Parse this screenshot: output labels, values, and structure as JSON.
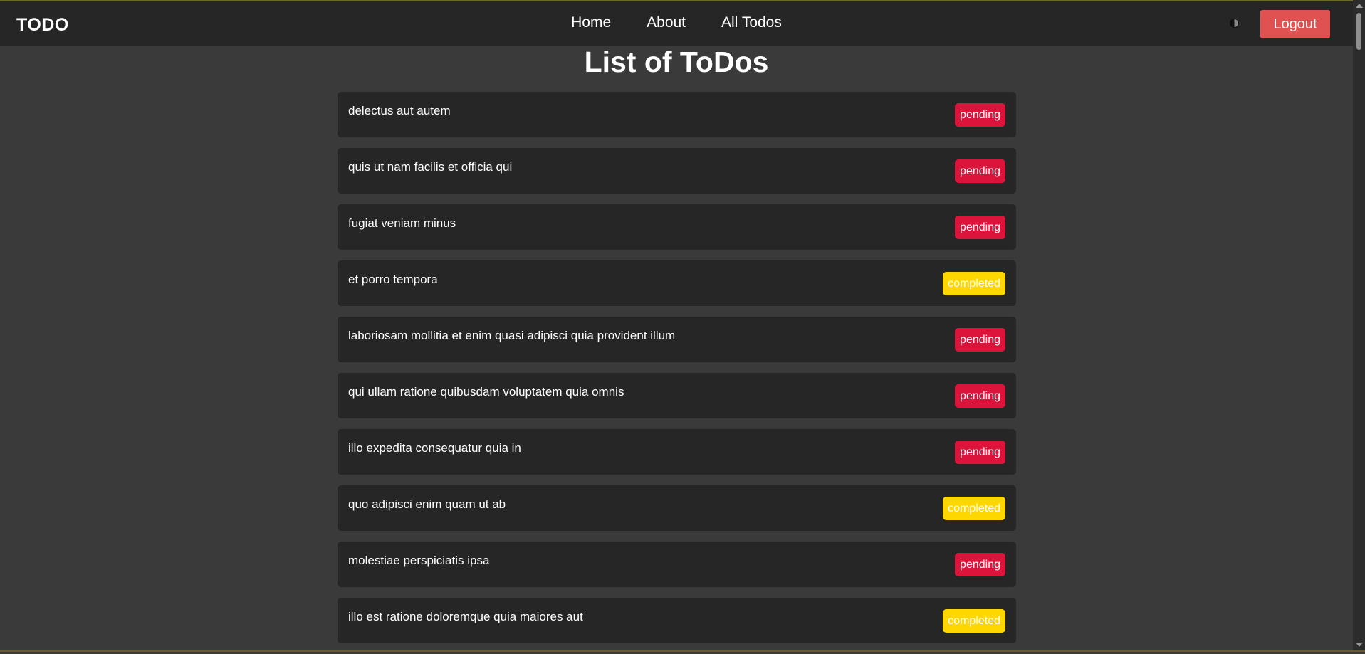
{
  "navbar": {
    "brand": "TODO",
    "links": [
      {
        "label": "Home"
      },
      {
        "label": "About"
      },
      {
        "label": "All Todos"
      }
    ],
    "theme_toggle_icon": "contrast-icon",
    "logout_label": "Logout"
  },
  "page": {
    "title": "List of ToDos"
  },
  "colors": {
    "pending": "#dc143c",
    "completed": "#ffd700",
    "logout": "#e05252"
  },
  "todos": [
    {
      "title": "delectus aut autem",
      "status": "pending"
    },
    {
      "title": "quis ut nam facilis et officia qui",
      "status": "pending"
    },
    {
      "title": "fugiat veniam minus",
      "status": "pending"
    },
    {
      "title": "et porro tempora",
      "status": "completed"
    },
    {
      "title": "laboriosam mollitia et enim quasi adipisci quia provident illum",
      "status": "pending"
    },
    {
      "title": "qui ullam ratione quibusdam voluptatem quia omnis",
      "status": "pending"
    },
    {
      "title": "illo expedita consequatur quia in",
      "status": "pending"
    },
    {
      "title": "quo adipisci enim quam ut ab",
      "status": "completed"
    },
    {
      "title": "molestiae perspiciatis ipsa",
      "status": "pending"
    },
    {
      "title": "illo est ratione doloremque quia maiores aut",
      "status": "completed"
    }
  ]
}
